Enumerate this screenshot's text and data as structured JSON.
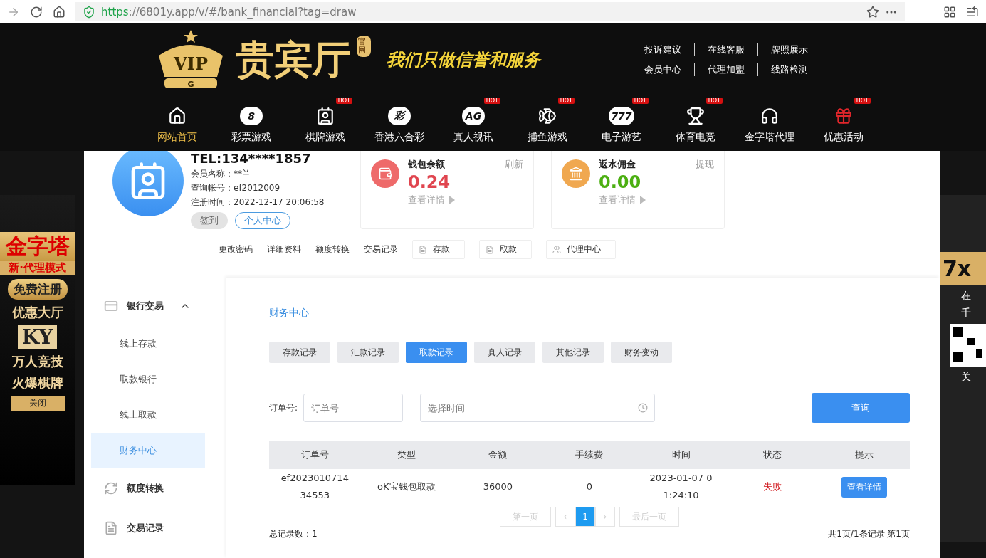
{
  "browser": {
    "url_scheme": "https",
    "url_rest": "://6801y.app/v/#/bank_financial?tag=draw"
  },
  "header": {
    "logo": {
      "crown_text": "VIP",
      "crown_letter": "G",
      "name": "贵宾厅",
      "badge": "官网"
    },
    "slogan": "我们只做信誉和服务",
    "top_links": [
      [
        {
          "label": "投诉建议"
        },
        {
          "label": "在线客服"
        },
        {
          "label": "牌照展示"
        }
      ],
      [
        {
          "label": "会员中心"
        },
        {
          "label": "代理加盟"
        },
        {
          "label": "线路检测"
        }
      ]
    ],
    "nav": [
      {
        "label": "网站首页",
        "selected": true
      },
      {
        "label": "彩票游戏",
        "selected": false,
        "icon_text": "8"
      },
      {
        "label": "棋牌游戏",
        "selected": false,
        "badge": "HOT"
      },
      {
        "label": "香港六合彩",
        "selected": false,
        "icon_text": "彩"
      },
      {
        "label": "真人视讯",
        "selected": false,
        "badge": "HOT",
        "icon_text": "AG"
      },
      {
        "label": "捕鱼游戏",
        "selected": false,
        "badge": "HOT"
      },
      {
        "label": "电子游艺",
        "selected": false,
        "badge": "HOT",
        "icon_text": "777"
      },
      {
        "label": "体育电竞",
        "selected": false,
        "badge": "HOT"
      },
      {
        "label": "金字塔代理",
        "selected": false
      },
      {
        "label": "优惠活动",
        "selected": false,
        "badge": "HOT"
      }
    ]
  },
  "left_ad": {
    "title": "金字塔",
    "subtitle": "新·代理模式",
    "register": "免费注册",
    "promo": "优惠大厅",
    "tiles": "KY",
    "line_1": "万人竞技",
    "line_2": "火爆棋牌",
    "close": "关闭"
  },
  "right_ad": {
    "title": "7x",
    "tag": "在",
    "line": "千",
    "close": "关"
  },
  "profile": {
    "tel": "TEL:134****1857",
    "fields": [
      {
        "label": "会员名称：",
        "value": "**兰"
      },
      {
        "label": "查询帐号：",
        "value": "ef2012009"
      },
      {
        "label": "注册时间：",
        "value": "2022-12-17 20:06:58"
      }
    ],
    "sign_in": "签到",
    "personal": "个人中心"
  },
  "cards": [
    {
      "kind": "wallet",
      "title": "钱包余额",
      "action": "刷新",
      "amount": "0.24",
      "color": "#e0454f",
      "link": "查看详情"
    },
    {
      "kind": "rebate",
      "title": "返水佣金",
      "action": "提现",
      "amount": "0.00",
      "color": "#4caf12",
      "link": "查看详情"
    }
  ],
  "quick_links": [
    {
      "kind": "text",
      "label": "更改密码"
    },
    {
      "kind": "text",
      "label": "详细资料"
    },
    {
      "kind": "text",
      "label": "额度转换"
    },
    {
      "kind": "text",
      "label": "交易记录"
    },
    {
      "kind": "button",
      "label": "存款"
    },
    {
      "kind": "button",
      "label": "取款"
    },
    {
      "kind": "button",
      "label": "代理中心"
    }
  ],
  "sidebar": [
    {
      "label": "银行交易",
      "expanded": true,
      "children": [
        {
          "label": "线上存款",
          "selected": false
        },
        {
          "label": "取款银行",
          "selected": false
        },
        {
          "label": "线上取款",
          "selected": false
        },
        {
          "label": "财务中心",
          "selected": true
        }
      ]
    },
    {
      "label": "额度转换"
    },
    {
      "label": "交易记录"
    }
  ],
  "main": {
    "breadcrumb": "财务中心",
    "tabs": [
      {
        "label": "存款记录",
        "selected": false
      },
      {
        "label": "汇款记录",
        "selected": false
      },
      {
        "label": "取款记录",
        "selected": true
      },
      {
        "label": "真人记录",
        "selected": false
      },
      {
        "label": "其他记录",
        "selected": false
      },
      {
        "label": "财务变动",
        "selected": false
      }
    ],
    "filter": {
      "label": "订单号:",
      "order_placeholder": "订单号",
      "time_placeholder": "选择时间",
      "query": "查询"
    },
    "table": {
      "columns": [
        "订单号",
        "类型",
        "金额",
        "手续费",
        "时间",
        "状态",
        "提示"
      ],
      "rows": [
        {
          "order": "ef202301071434553",
          "type": "oK宝钱包取款",
          "amount": "36000",
          "fee": "0",
          "time": "2023-01-07 01:24:10",
          "status": "失败",
          "action": "查看详情"
        }
      ]
    },
    "pagination": {
      "first": "第一页",
      "prev": "‹",
      "page": "1",
      "next": "›",
      "last": "最后一页"
    },
    "total": "总记录数：1",
    "summary": "共1页/1条记录 第1页"
  }
}
